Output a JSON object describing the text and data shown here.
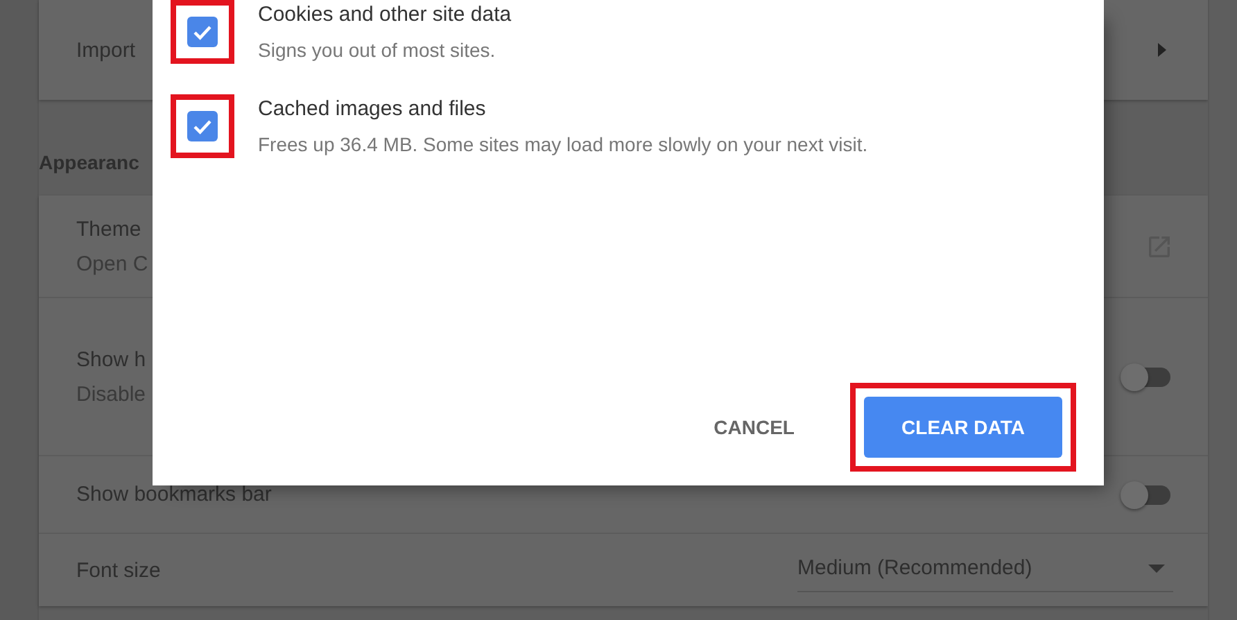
{
  "settings": {
    "import_row": {
      "label": "Import"
    },
    "section_heading": "Appearanc",
    "appearance_rows": [
      {
        "kind": "link",
        "title": "Theme",
        "subtitle": "Open C"
      },
      {
        "kind": "toggle",
        "title": "Show h",
        "subtitle": "Disable",
        "on": false
      },
      {
        "kind": "toggle",
        "title": "Show bookmarks bar",
        "on": false
      },
      {
        "kind": "select",
        "title": "Font size",
        "value": "Medium (Recommended)"
      }
    ]
  },
  "dialog": {
    "options": [
      {
        "title": "Cookies and other site data",
        "description": "Signs you out of most sites.",
        "checked": true,
        "highlighted": true
      },
      {
        "title": "Cached images and files",
        "description": "Frees up 36.4 MB. Some sites may load more slowly on your next visit.",
        "checked": true,
        "highlighted": true
      }
    ],
    "buttons": [
      {
        "kind": "text",
        "label": "CANCEL",
        "highlighted": false
      },
      {
        "kind": "primary",
        "label": "CLEAR DATA",
        "highlighted": true
      }
    ]
  }
}
